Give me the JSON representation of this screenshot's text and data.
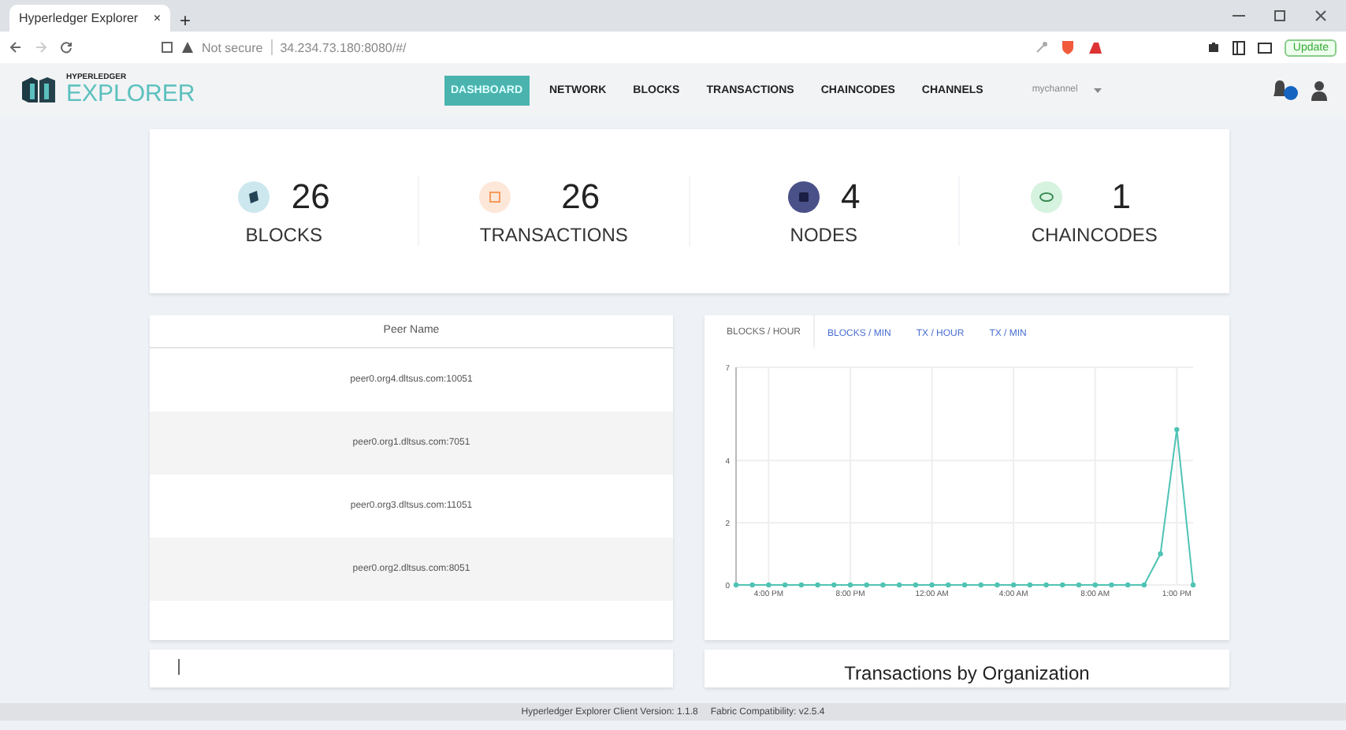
{
  "browser": {
    "tab_title": "Hyperledger Explorer",
    "tab_close": "×",
    "new_tab": "+",
    "address": {
      "security": "Not secure",
      "url": "34.234.73.180:8080/#/"
    },
    "update_button": "Update"
  },
  "header": {
    "logo_small": "HYPERLEDGER",
    "logo_large": "EXPLORER",
    "nav": [
      {
        "label": "DASHBOARD",
        "selected": true
      },
      {
        "label": "NETWORK",
        "selected": false
      },
      {
        "label": "BLOCKS",
        "selected": false
      },
      {
        "label": "TRANSACTIONS",
        "selected": false
      },
      {
        "label": "CHAINCODES",
        "selected": false
      },
      {
        "label": "CHANNELS",
        "selected": false
      }
    ],
    "channel_select": "mychannel"
  },
  "stats": [
    {
      "kind": "blocks",
      "value": "26",
      "label": "BLOCKS"
    },
    {
      "kind": "transactions",
      "value": "26",
      "label": "TRANSACTIONS"
    },
    {
      "kind": "nodes",
      "value": "4",
      "label": "NODES"
    },
    {
      "kind": "chaincodes",
      "value": "1",
      "label": "CHAINCODES"
    }
  ],
  "peers": {
    "column": "Peer Name",
    "rows": [
      "peer0.org4.dltsus.com:10051",
      "peer0.org1.dltsus.com:7051",
      "peer0.org3.dltsus.com:11051",
      "peer0.org2.dltsus.com:8051"
    ]
  },
  "chart_tabs": [
    {
      "label": "BLOCKS / HOUR",
      "selected": true
    },
    {
      "label": "BLOCKS / MIN",
      "selected": false
    },
    {
      "label": "TX / HOUR",
      "selected": false
    },
    {
      "label": "TX / MIN",
      "selected": false
    }
  ],
  "chart_data": {
    "type": "line",
    "categories": [
      null,
      null,
      "4:00 PM",
      null,
      null,
      null,
      null,
      "8:00 PM",
      null,
      null,
      null,
      null,
      "12:00 AM",
      null,
      null,
      null,
      null,
      "4:00 AM",
      null,
      null,
      null,
      null,
      "8:00 AM",
      null,
      null,
      null,
      null,
      "1:00 PM",
      null
    ],
    "series": [
      {
        "color": "#4fc3b4",
        "marker": true,
        "values": [
          0,
          0,
          0,
          0,
          0,
          0,
          0,
          0,
          0,
          0,
          0,
          0,
          0,
          0,
          0,
          0,
          0,
          0,
          0,
          0,
          0,
          0,
          0,
          0,
          0,
          0,
          1,
          5,
          0
        ]
      }
    ],
    "ylim": [
      0,
      7
    ],
    "yticks": [
      0,
      2,
      4,
      7
    ],
    "grid": true
  },
  "org_chart_title": "Transactions by Organization",
  "footer": {
    "version": "Hyperledger Explorer Client Version: 1.1.8",
    "compat": "Fabric Compatibility: v2.5.4"
  }
}
